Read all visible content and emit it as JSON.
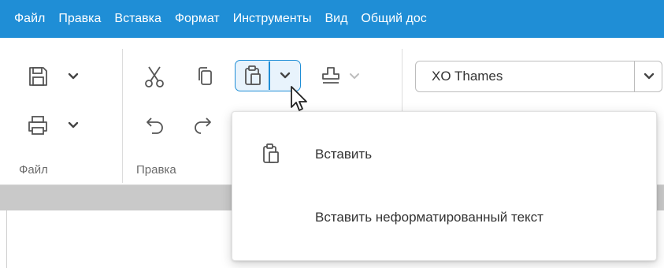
{
  "menubar": {
    "items": [
      "Файл",
      "Правка",
      "Вставка",
      "Формат",
      "Инструменты",
      "Вид",
      "Общий дос"
    ]
  },
  "toolbar": {
    "groups": {
      "file": "Файл",
      "edit": "Правка"
    },
    "font": {
      "value": "XO Thames"
    }
  },
  "paste_menu": {
    "items": [
      {
        "label": "Вставить",
        "icon": "paste-icon"
      },
      {
        "label": "Вставить неформатированный текст"
      }
    ]
  },
  "colors": {
    "accent": "#1f8ed6",
    "menubar_text": "#ffffff",
    "band": "#c9c9c9"
  }
}
